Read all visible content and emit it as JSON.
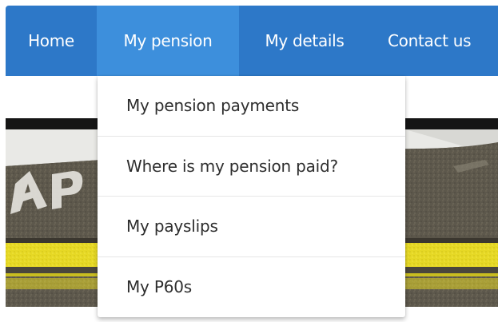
{
  "nav": {
    "items": [
      {
        "label": "Home"
      },
      {
        "label": "My pension",
        "active": true
      },
      {
        "label": "My details"
      },
      {
        "label": "Contact us"
      }
    ]
  },
  "dropdown": {
    "parent": "My pension",
    "items": [
      {
        "label": "My pension payments"
      },
      {
        "label": "Where is my pension paid?"
      },
      {
        "label": "My payslips"
      },
      {
        "label": "My P60s"
      }
    ]
  },
  "colors": {
    "nav_background": "#2d78c8",
    "nav_active": "#3d8fdc",
    "nav_text": "#ffffff",
    "dropdown_background": "#ffffff",
    "dropdown_text": "#2e2e2e"
  },
  "hero": {
    "icon": "road-marking-photo"
  }
}
